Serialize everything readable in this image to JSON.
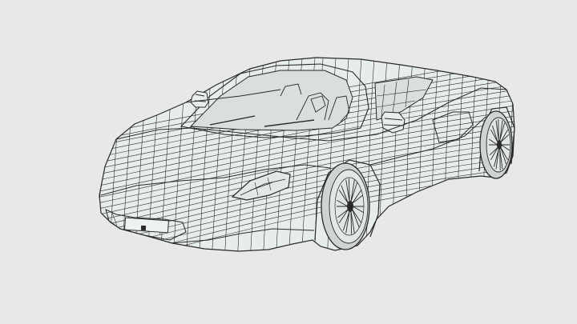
{
  "viewport": {
    "background": "#e8e8e8",
    "line_color": "#2a2a2a",
    "panel_fill": "#e7eded",
    "glass_fill": "#d9dede",
    "tire_fill": "#cfd3d3"
  },
  "model": {
    "subject": "sports-car",
    "display_mode": "wireframe"
  }
}
